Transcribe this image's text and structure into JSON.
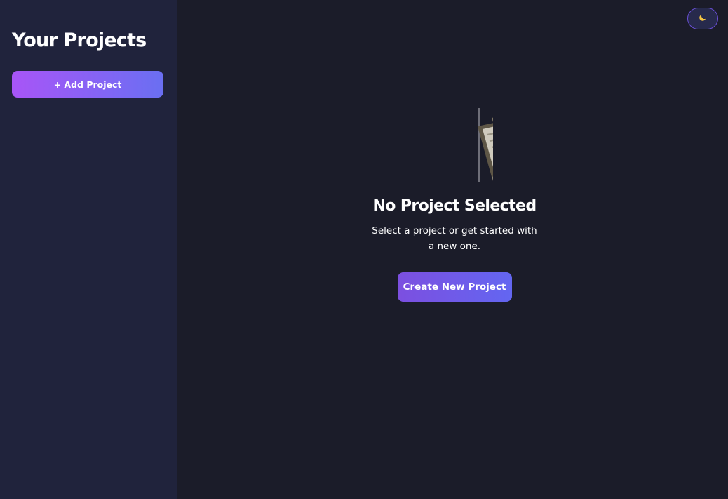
{
  "sidebar": {
    "title": "Your Projects",
    "add_button_label": "+ Add Project"
  },
  "header": {
    "theme_toggle_icon": "moon-icon"
  },
  "main": {
    "empty_state": {
      "illustration": "clipboard-icon",
      "title": "No Project Selected",
      "description": "Select a project or get started with a new one.",
      "button_label": "Create New Project"
    }
  },
  "colors": {
    "sidebar_bg": "#20233c",
    "main_bg": "#1b1c29",
    "accent_start": "#a855f7",
    "accent_end": "#6366f1",
    "moon": "#f5c542"
  }
}
